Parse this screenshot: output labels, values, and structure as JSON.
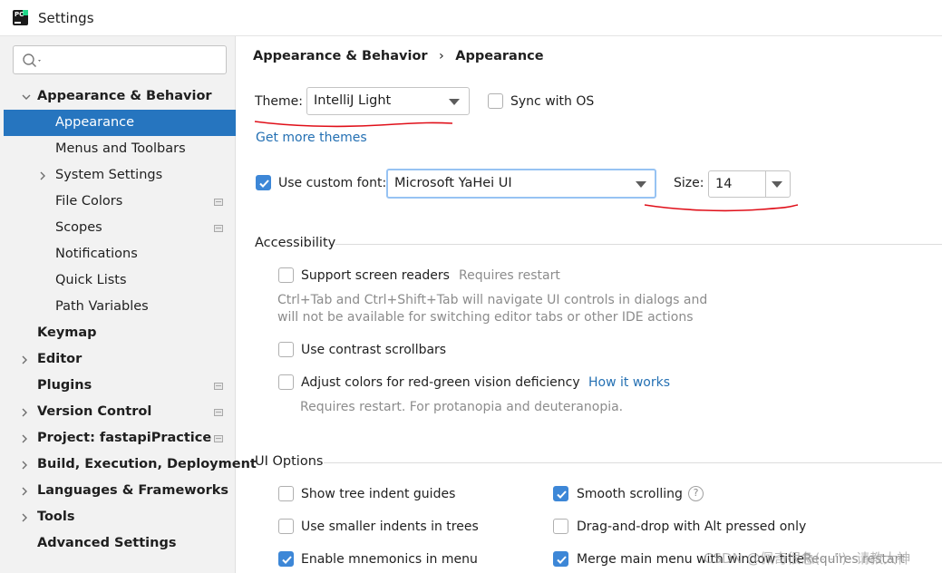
{
  "window": {
    "title": "Settings"
  },
  "sidebar": {
    "search_placeholder": "",
    "items": [
      {
        "label": "Appearance & Behavior",
        "expanded": true
      },
      {
        "label": "Appearance",
        "selected": true
      },
      {
        "label": "Menus and Toolbars"
      },
      {
        "label": "System Settings"
      },
      {
        "label": "File Colors"
      },
      {
        "label": "Scopes"
      },
      {
        "label": "Notifications"
      },
      {
        "label": "Quick Lists"
      },
      {
        "label": "Path Variables"
      },
      {
        "label": "Keymap"
      },
      {
        "label": "Editor"
      },
      {
        "label": "Plugins"
      },
      {
        "label": "Version Control"
      },
      {
        "label": "Project: fastapiPractice"
      },
      {
        "label": "Build, Execution, Deployment"
      },
      {
        "label": "Languages & Frameworks"
      },
      {
        "label": "Tools"
      },
      {
        "label": "Advanced Settings"
      }
    ]
  },
  "breadcrumb": {
    "parent": "Appearance & Behavior",
    "separator": "›",
    "current": "Appearance"
  },
  "theme": {
    "label": "Theme:",
    "value": "IntelliJ Light",
    "sync_label": "Sync with OS",
    "sync_checked": false,
    "more_themes_link": "Get more themes"
  },
  "font": {
    "checkbox_label": "Use custom font:",
    "checked": true,
    "value": "Microsoft YaHei UI",
    "size_label": "Size:",
    "size_value": "14"
  },
  "accessibility": {
    "title": "Accessibility",
    "screen_readers_label": "Support screen readers",
    "screen_readers_note": "Requires restart",
    "screen_readers_desc_1": "Ctrl+Tab and Ctrl+Shift+Tab will navigate UI controls in dialogs and",
    "screen_readers_desc_2": "will not be available for switching editor tabs or other IDE actions",
    "contrast_label": "Use contrast scrollbars",
    "color_adjust_label": "Adjust colors for red-green vision deficiency",
    "how_it_works_link": "How it works",
    "color_adjust_note": "Requires restart. For protanopia and deuteranopia."
  },
  "ui_options": {
    "title": "UI Options",
    "tree_indent_label": "Show tree indent guides",
    "smaller_indents_label": "Use smaller indents in trees",
    "mnemonics_menu_label": "Enable mnemonics in menu",
    "smooth_scrolling_label": "Smooth scrolling",
    "drag_drop_label": "Drag-and-drop with Alt pressed only",
    "merge_menu_label": "Merge main menu with window title",
    "merge_menu_note": "Requires restart"
  },
  "watermark": {
    "text": "CSDN @佩奇很急(- -'')- 请教大神"
  },
  "colors": {
    "accent": "#2675bf",
    "checkbox": "#3d87d7",
    "link": "#2470b3",
    "annotation": "#e0101a"
  }
}
